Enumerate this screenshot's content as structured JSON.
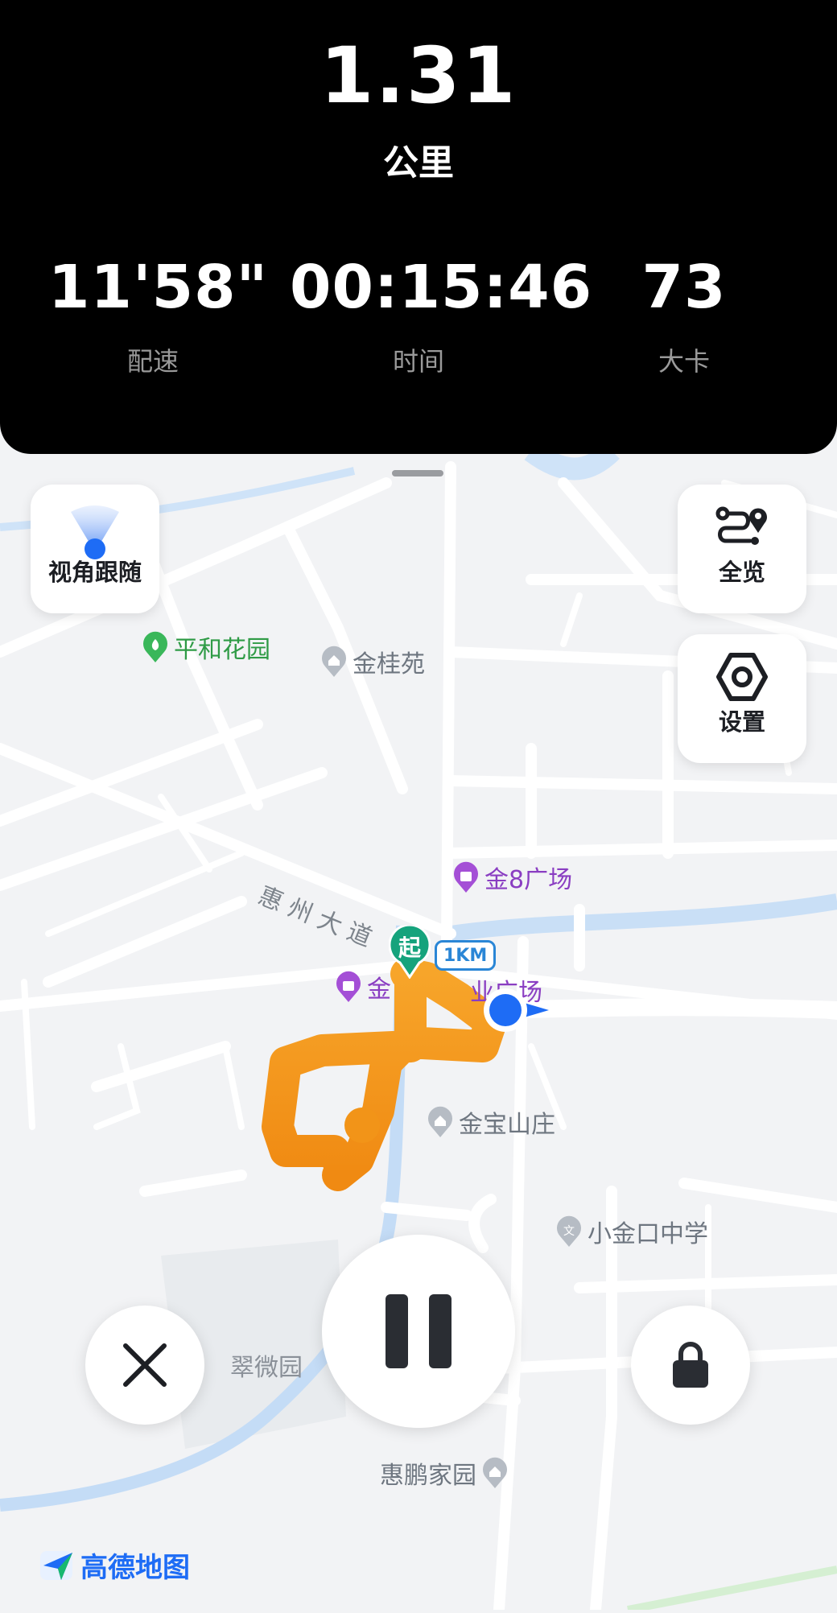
{
  "stats": {
    "distance_value": "1.31",
    "distance_unit": "公里",
    "pace_value": "11'58\"",
    "pace_label": "配速",
    "time_value": "00:15:46",
    "time_label": "时间",
    "calories_value": "73",
    "calories_label": "大卡"
  },
  "controls": {
    "follow_label": "视角跟随",
    "overview_label": "全览",
    "settings_label": "设置"
  },
  "map": {
    "pois": {
      "pinghe": "平和花园",
      "jingui": "金桂苑",
      "jin8": "金8广场",
      "jinplaza": "金",
      "jinplaza_tail": "业广场",
      "jinbao": "金宝山庄",
      "xiaojinkou": "小金口中学",
      "cuiwei": "翠微园",
      "huipeng": "惠鹏家园"
    },
    "road_label": "惠 州 大 道",
    "start_marker": "起",
    "km_marker": "1KM",
    "colors": {
      "route": "#f59a1a",
      "location": "#1e6cf5",
      "start": "#15a37c"
    }
  },
  "brand": {
    "logo_text": "高德地图"
  },
  "icons": [
    "follow-view-icon",
    "route-overview-icon",
    "settings-hexagon-icon",
    "close-icon",
    "pause-icon",
    "lock-icon",
    "amap-logo-icon"
  ]
}
